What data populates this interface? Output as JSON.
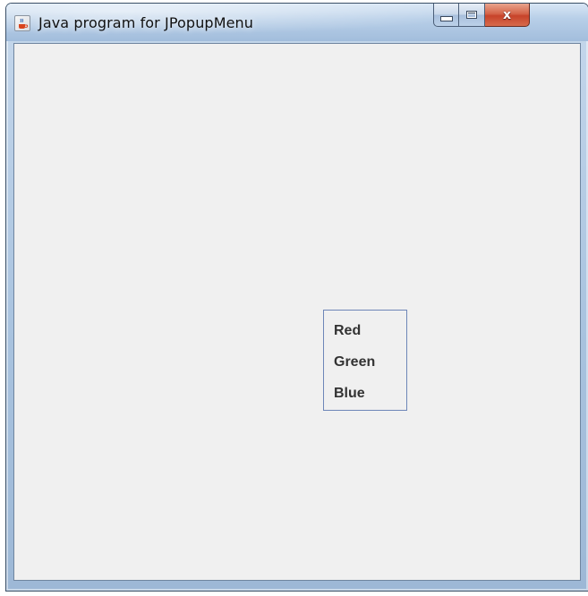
{
  "window": {
    "title": "Java program for JPopupMenu",
    "icon": "java-cup-icon",
    "controls": {
      "minimize_icon": "minimize-icon",
      "maximize_icon": "maximize-icon",
      "close_glyph": "x"
    }
  },
  "popup_menu": {
    "items": [
      {
        "label": "Red"
      },
      {
        "label": "Green"
      },
      {
        "label": "Blue"
      }
    ]
  },
  "colors": {
    "client_background": "#f0f0f0",
    "popup_border": "#6e86b8",
    "menu_text": "#333333",
    "close_button": "#c7432a"
  }
}
